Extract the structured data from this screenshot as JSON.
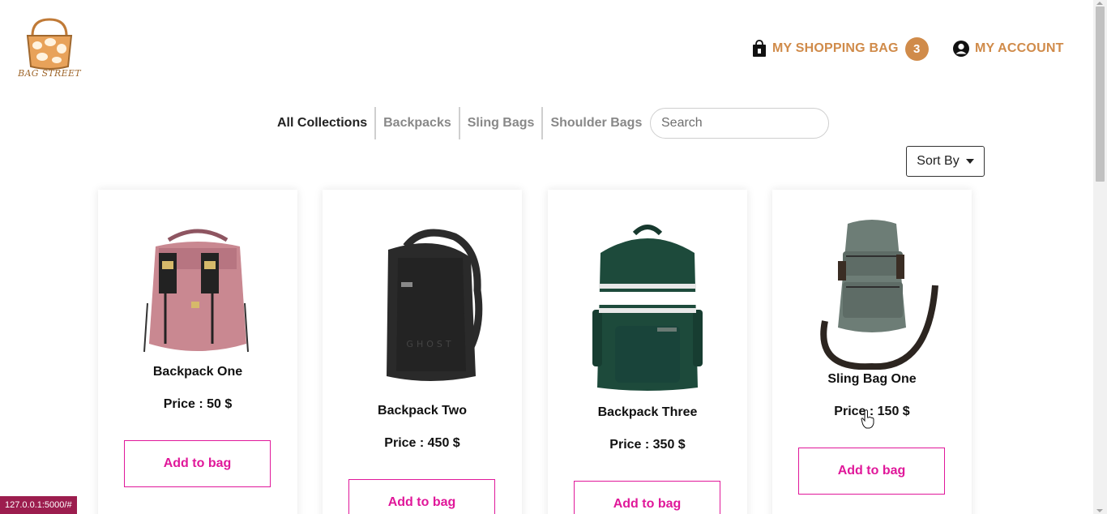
{
  "brand": {
    "logo_text": "BAG STREET",
    "accent_color": "#d08b4a"
  },
  "header": {
    "bag_label": "MY SHOPPING BAG",
    "bag_count": "3",
    "account_label": "MY ACCOUNT",
    "bag_icon": "shopping-bag-icon",
    "account_icon": "user-circle-icon"
  },
  "categories": [
    "All Collections",
    "Backpacks",
    "Sling Bags",
    "Shoulder Bags"
  ],
  "search": {
    "placeholder": "Search",
    "value": ""
  },
  "sort": {
    "label": "Sort By"
  },
  "products": [
    {
      "name": "Backpack One",
      "price": "Price : 50 $",
      "button": "Add to bag"
    },
    {
      "name": "Backpack Two",
      "price": "Price : 450 $",
      "button": "Add to bag"
    },
    {
      "name": "Backpack Three",
      "price": "Price : 350 $",
      "button": "Add to bag"
    },
    {
      "name": "Sling Bag One",
      "price": "Price : 150 $",
      "button": "Add to bag"
    }
  ],
  "status": {
    "url": "127.0.0.1:5000/#"
  },
  "colors": {
    "button": "#e0189a",
    "status_bar": "#9c1d4e"
  }
}
